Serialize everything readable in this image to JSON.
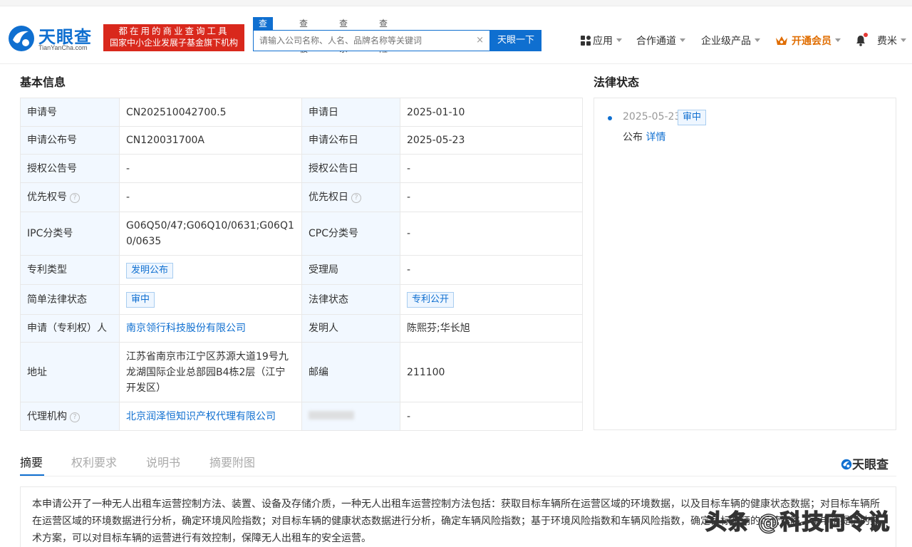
{
  "header": {
    "logo_name": "天眼查",
    "logo_sub": "TianYanCha.com",
    "slogan_line1": "都在用的商业查询工具",
    "slogan_line2": "国家中小企业发展子基金旗下机构",
    "search_tabs": [
      "查公司",
      "查老板",
      "查关系",
      "查风险"
    ],
    "search_placeholder": "请输入公司名称、人名、品牌名称等关键词",
    "search_clear": "×",
    "search_button": "天眼一下",
    "nav": {
      "apps": "应用",
      "cooperation": "合作通道",
      "enterprise": "企业级产品",
      "vip": "开通会员",
      "user": "费米"
    }
  },
  "basic_info": {
    "title": "基本信息",
    "rows": [
      {
        "k1": "申请号",
        "v1": "CN202510042700.5",
        "k2": "申请日",
        "v2": "2025-01-10"
      },
      {
        "k1": "申请公布号",
        "v1": "CN120031700A",
        "k2": "申请公布日",
        "v2": "2025-05-23"
      },
      {
        "k1": "授权公告号",
        "v1": "-",
        "k2": "授权公告日",
        "v2": "-"
      },
      {
        "k1": "优先权号",
        "v1": "-",
        "k2": "优先权日",
        "v2": "-"
      },
      {
        "k1": "IPC分类号",
        "v1": "G06Q50/47;G06Q10/0631;G06Q10/0635",
        "k2": "CPC分类号",
        "v2": "-"
      },
      {
        "k1": "专利类型",
        "v1": "发明公布",
        "k2": "受理局",
        "v2": "-"
      },
      {
        "k1": "简单法律状态",
        "v1": "审中",
        "k2": "法律状态",
        "v2": "专利公开"
      },
      {
        "k1": "申请（专利权）人",
        "v1": "南京领行科技股份有限公司",
        "k2": "发明人",
        "v2": "陈熙芬;华长旭"
      },
      {
        "k1": "地址",
        "v1": "江苏省南京市江宁区苏源大道19号九龙湖国际企业总部园B4栋2层（江宁开发区）",
        "k2": "邮编",
        "v2": "211100"
      },
      {
        "k1": "代理机构",
        "v1": "北京润泽恒知识产权代理有限公司",
        "k2": "",
        "v2": "-"
      }
    ],
    "help_glyph": "?"
  },
  "legal": {
    "title": "法律状态",
    "date": "2025-05-23",
    "tag": "审中",
    "event": "公布",
    "detail_link": "详情"
  },
  "tabs": {
    "items": [
      "摘要",
      "权利要求",
      "说明书",
      "摘要附图"
    ],
    "active": 0,
    "brand": "天眼查"
  },
  "abstract": {
    "text": "本申请公开了一种无人出租车运营控制方法、装置、设备及存储介质，一种无人出租车运营控制方法包括：获取目标车辆所在运营区域的环境数据，以及目标车辆的健康状态数据；对目标车辆所在运营区域的环境数据进行分析，确定环境风险指数；对目标车辆的健康状态数据进行分析，确定车辆风险指数；基于环境风险指数和车辆风险指数，确定目标车辆的运营策略。本申请提供的技术方案，可以对目标车辆的运营进行有效控制，保障无人出租车的安全运营。"
  },
  "watermark": "头条 @科技向令说",
  "colors": {
    "brand_blue": "#0f6fd0",
    "slogan_red": "#d9281c",
    "vip_orange": "#e06d00",
    "key_cell_bg": "#f2f8ff"
  },
  "icons": [
    "logo-mark-icon",
    "apps-grid-icon",
    "crown-icon",
    "bell-icon",
    "help-circle-icon",
    "clear-icon",
    "caret-down-icon"
  ]
}
